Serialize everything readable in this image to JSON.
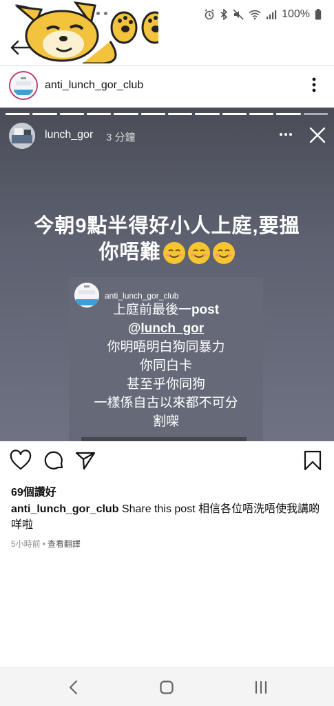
{
  "status_bar": {
    "battery": "100%"
  },
  "header": {
    "username": "anti_lunch_gor_club"
  },
  "story": {
    "username": "lunch_gor",
    "time": "3 分鐘",
    "caption_line1": "今朝9點半得好小人上庭,要搵",
    "caption_line2": "你唔難",
    "repost": {
      "username": "anti_lunch_gor_club",
      "lines": {
        "l1_text": "上庭前最後一",
        "l1_bold": "post",
        "l2_at": "@",
        "l2_mention": "lunch_gor",
        "l3": "你明唔明白狗同暴力",
        "l4": "你同白卡",
        "l5": "甚至乎你同狗",
        "l6": "一樣係自古以來都不可分",
        "l7": "割㗎"
      }
    }
  },
  "post": {
    "likes": "69個讚好",
    "caption_user": "anti_lunch_gor_club",
    "caption_text": " Share this post 相信各位唔洗唔使我講啲咩啦",
    "time": "5小時前",
    "separator": "•",
    "translate": "查看翻譯"
  },
  "icons": {
    "back": "arrow-left-icon",
    "more": "vertical-dots-icon",
    "like": "heart-icon",
    "comment": "comment-bubble-icon",
    "share": "paper-plane-icon",
    "save": "bookmark-icon",
    "close": "close-icon"
  }
}
